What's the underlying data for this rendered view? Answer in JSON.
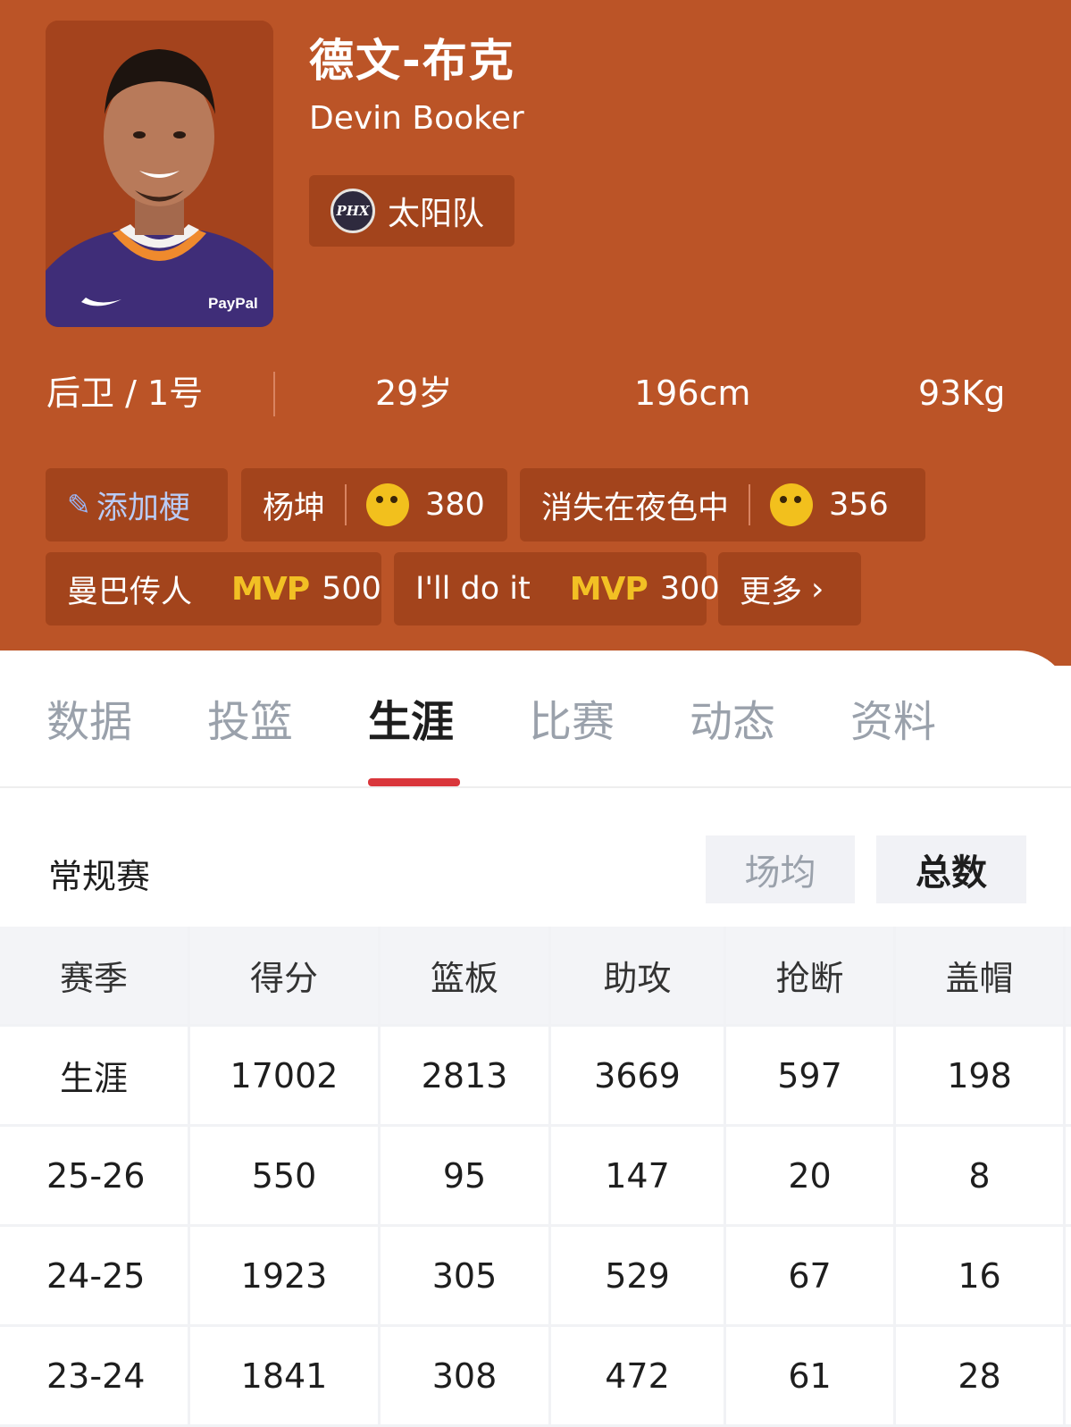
{
  "player": {
    "name_cn": "德文-布克",
    "name_en": "Devin Booker",
    "team": "太阳队",
    "team_logo_text": "PHX",
    "position": "后卫 / 1号",
    "age": "29岁",
    "height": "196cm",
    "weight": "93Kg",
    "jersey_sponsor": "PayPal"
  },
  "tags": {
    "add_label": "添加梗",
    "items": [
      {
        "label": "杨坤",
        "count": "380",
        "icon": "grin-emoji-icon"
      },
      {
        "label": "消失在夜色中",
        "count": "356",
        "icon": "rose-emoji-icon"
      },
      {
        "label": "曼巴传人",
        "badge": "MVP",
        "count": "500"
      },
      {
        "label": "I'll do it",
        "badge": "MVP",
        "count": "300"
      }
    ],
    "more_label": "更多"
  },
  "tabs": [
    {
      "label": "数据"
    },
    {
      "label": "投篮"
    },
    {
      "label": "生涯",
      "active": true
    },
    {
      "label": "比赛"
    },
    {
      "label": "动态"
    },
    {
      "label": "资料"
    }
  ],
  "section": {
    "title": "常规赛",
    "toggle_avg": "场均",
    "toggle_total": "总数",
    "selected": "总数"
  },
  "table": {
    "headers": [
      "赛季",
      "得分",
      "篮板",
      "助攻",
      "抢断",
      "盖帽"
    ],
    "rows": [
      [
        "生涯",
        "17002",
        "2813",
        "3669",
        "597",
        "198"
      ],
      [
        "25-26",
        "550",
        "95",
        "147",
        "20",
        "8"
      ],
      [
        "24-25",
        "1923",
        "305",
        "529",
        "67",
        "16"
      ],
      [
        "23-24",
        "1841",
        "308",
        "472",
        "61",
        "28"
      ]
    ]
  },
  "colors": {
    "header_bg": "#bb5427",
    "chip_bg": "#a3441c",
    "active_underline": "#d9363b",
    "mvp": "#f2c024"
  }
}
